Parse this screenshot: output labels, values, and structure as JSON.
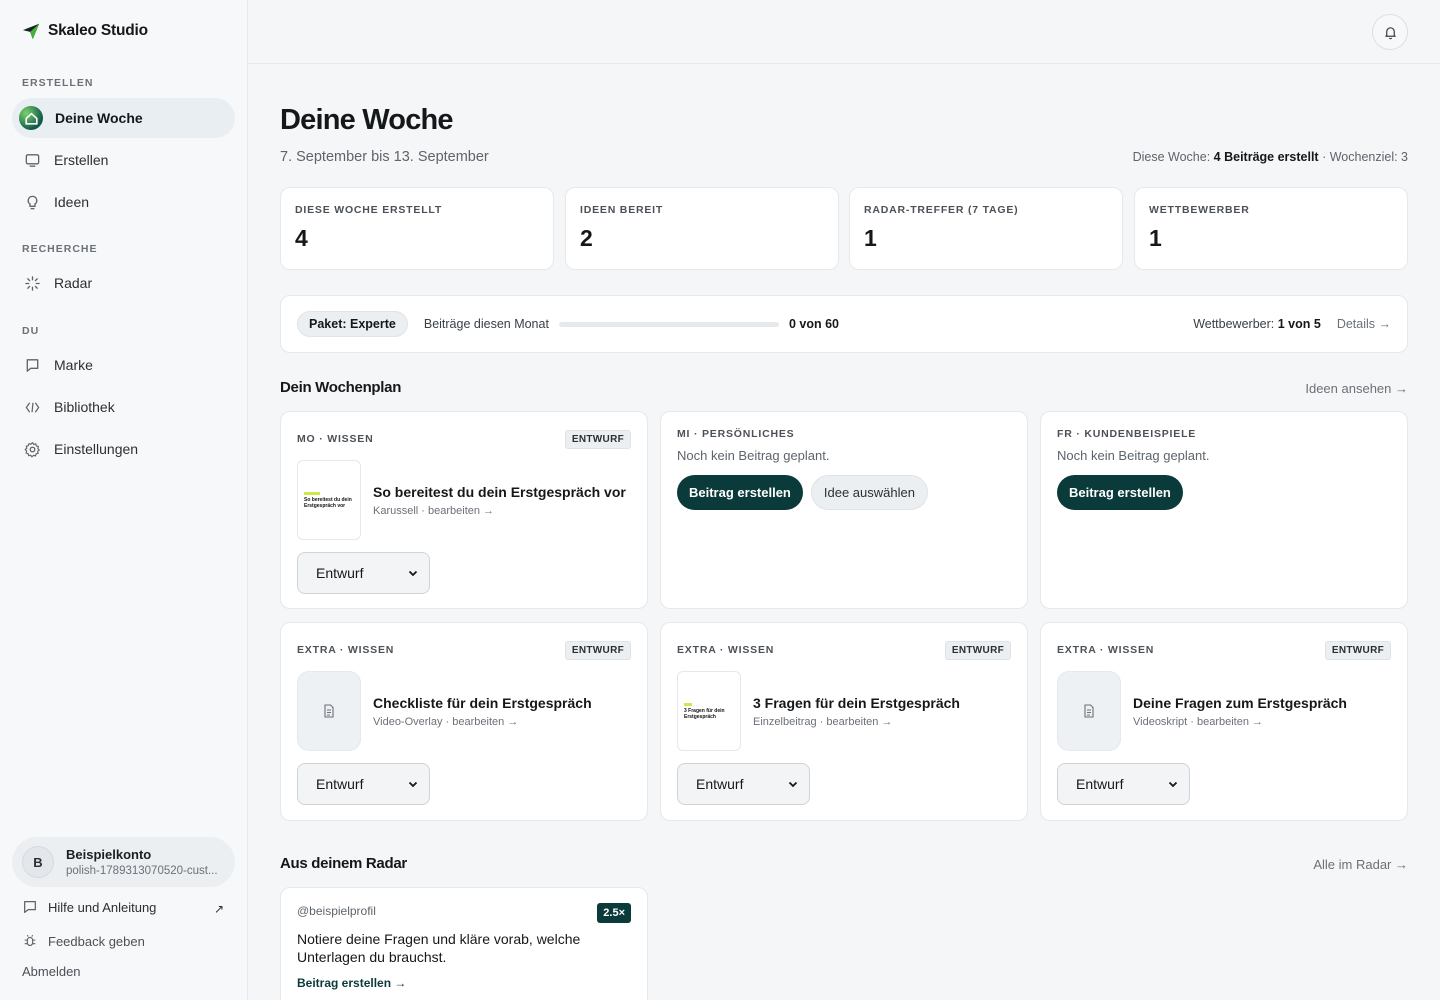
{
  "brand": {
    "name": "Skaleo Studio"
  },
  "sidebar": {
    "sections": [
      "ERSTELLEN",
      "RECHERCHE",
      "DU"
    ],
    "items": [
      {
        "label": "Deine Woche",
        "icon": "home-icon",
        "active": true
      },
      {
        "label": "Erstellen",
        "icon": "monitor-icon"
      },
      {
        "label": "Ideen",
        "icon": "lightbulb-icon"
      },
      {
        "label": "Radar",
        "icon": "radar-icon"
      },
      {
        "label": "Marke",
        "icon": "flag-icon"
      },
      {
        "label": "Bibliothek",
        "icon": "code-icon"
      },
      {
        "label": "Einstellungen",
        "icon": "gear-icon"
      }
    ],
    "account": {
      "initial": "B",
      "name": "Beispielkonto",
      "id": "polish-1789313070520-cust..."
    },
    "footer": {
      "help": "Hilfe und Anleitung",
      "feedback": "Feedback geben",
      "logout": "Abmelden"
    }
  },
  "header": {
    "title": "Deine Woche",
    "subtitle": "7. September bis 13. September",
    "summary_prefix": "Diese Woche:",
    "summary_bold": "4 Beiträge erstellt",
    "summary_suffix": "· Wochenziel: 3"
  },
  "stats": [
    {
      "label": "DIESE WOCHE ERSTELLT",
      "value": "4"
    },
    {
      "label": "IDEEN BEREIT",
      "value": "2"
    },
    {
      "label": "RADAR-TREFFER (7 TAGE)",
      "value": "1"
    },
    {
      "label": "WETTBEWERBER",
      "value": "1"
    }
  ],
  "plan": {
    "package": "Paket: Experte",
    "posts_label": "Beiträge diesen Monat",
    "posts_count": "0 von 60",
    "posts_fraction": 0,
    "competitors_label": "Wettbewerber:",
    "competitors_value": "1 von 5",
    "details": "Details →"
  },
  "weekplan": {
    "title": "Dein Wochenplan",
    "link": "Ideen ansehen →",
    "cards": [
      {
        "tag": "MO · WISSEN",
        "badge": "ENTWURF",
        "title": "So bereitest du dein Erstgespräch vor",
        "meta": "Karussell · bearbeiten →",
        "thumb_text": "So bereitest du dein Erstgespräch vor",
        "status": "Entwurf"
      },
      {
        "tag": "MI · PERSÖNLICHES",
        "empty": "Noch kein Beitrag geplant.",
        "primary": "Beitrag erstellen",
        "secondary": "Idee auswählen"
      },
      {
        "tag": "FR · KUNDENBEISPIELE",
        "empty": "Noch kein Beitrag geplant.",
        "primary": "Beitrag erstellen"
      },
      {
        "tag": "EXTRA · WISSEN",
        "badge": "ENTWURF",
        "title": "Checkliste für dein Erstgespräch",
        "meta": "Video-Overlay · bearbeiten →",
        "status": "Entwurf"
      },
      {
        "tag": "EXTRA · WISSEN",
        "badge": "ENTWURF",
        "title": "3 Fragen für dein Erstgespräch",
        "meta": "Einzelbeitrag · bearbeiten →",
        "thumb_text": "3 Fragen für dein Erstgespräch",
        "status": "Entwurf"
      },
      {
        "tag": "EXTRA · WISSEN",
        "badge": "ENTWURF",
        "title": "Deine Fragen zum Erstgespräch",
        "meta": "Videoskript · bearbeiten →",
        "status": "Entwurf"
      }
    ]
  },
  "radar": {
    "title": "Aus deinem Radar",
    "link": "Alle im Radar →",
    "card": {
      "handle": "@beispielprofil",
      "score": "2.5×",
      "text": "Notiere deine Fragen und kläre vorab, welche Unterlagen du brauchst.",
      "cta": "Beitrag erstellen →"
    }
  },
  "colors": {
    "accent": "#0b3a3a",
    "brand_green": "#cde84a"
  }
}
